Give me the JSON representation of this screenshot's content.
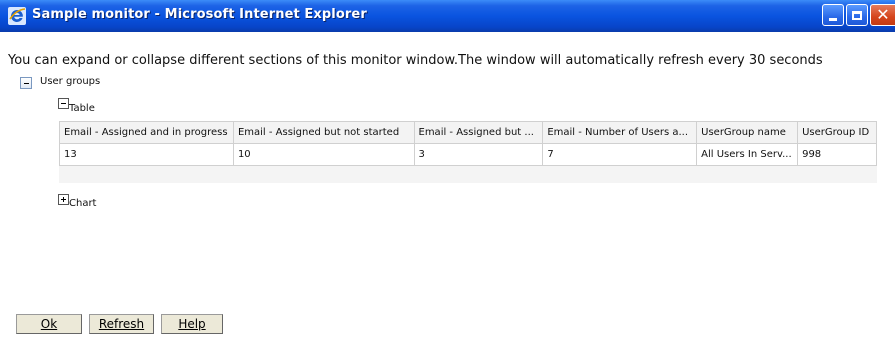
{
  "window": {
    "title": "Sample monitor - Microsoft Internet Explorer",
    "minimize_label": "Minimize",
    "maximize_label": "Maximize",
    "close_label": "Close"
  },
  "intro_text": "You can expand or collapse different sections of this monitor window.The window will automatically refresh every 30 seconds",
  "sections": {
    "user_groups": {
      "label": "User groups",
      "state": "expanded"
    },
    "table": {
      "label": "Table",
      "state": "expanded"
    },
    "chart": {
      "label": "Chart",
      "state": "collapsed"
    }
  },
  "table": {
    "columns": [
      "Email - Assigned and in progress",
      "Email - Assigned but not started",
      "Email - Assigned but ...",
      "Email - Number of Users a...",
      "UserGroup name",
      "UserGroup ID"
    ],
    "rows": [
      [
        "13",
        "10",
        "3",
        "7",
        "All Users In Serv...",
        "998"
      ]
    ]
  },
  "buttons": {
    "ok": "Ok",
    "refresh": "Refresh",
    "help": "Help"
  },
  "colors": {
    "titlebar": "#0a54e0",
    "close_button": "#d5451c",
    "button_face": "#ece9d8"
  },
  "icons": {
    "app": "internet-explorer-icon"
  }
}
